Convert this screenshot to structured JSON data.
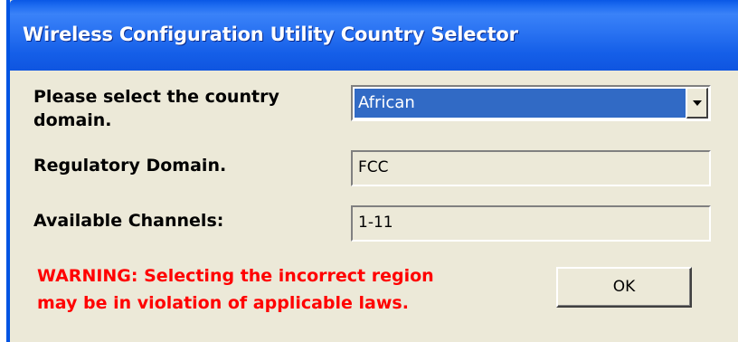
{
  "window": {
    "title": "Wireless Configuration Utility Country Selector"
  },
  "country": {
    "label_line1": "Please select the country",
    "label_line2": "domain.",
    "selected": "African"
  },
  "regulatory": {
    "label": "Regulatory Domain.",
    "value": "FCC"
  },
  "channels": {
    "label": "Available Channels:",
    "value": "1-11"
  },
  "warning": {
    "line1": "WARNING: Selecting the incorrect region",
    "line2": "may be in violation of applicable laws."
  },
  "buttons": {
    "ok_label": "OK"
  },
  "colors": {
    "titlebar": "#2a73f2",
    "window_bg": "#ece9d8",
    "selection": "#316ac5",
    "warning": "#ff0000"
  },
  "icons": {
    "dropdown": "chevron-down-icon"
  }
}
